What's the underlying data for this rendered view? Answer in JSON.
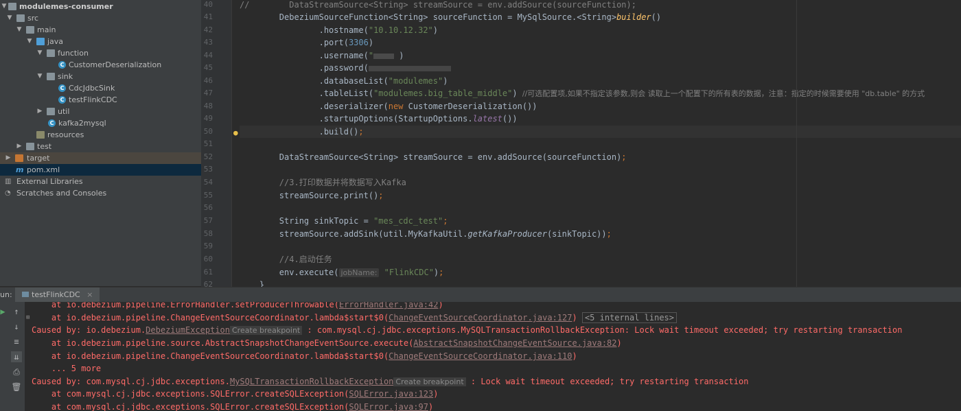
{
  "tree": [
    {
      "label": "modulemes-consumer",
      "bold": true
    },
    {
      "label": "src"
    },
    {
      "label": "main"
    },
    {
      "label": "java"
    },
    {
      "label": "function"
    },
    {
      "label": "CustomerDeserialization"
    },
    {
      "label": "sink"
    },
    {
      "label": "CdcJdbcSink"
    },
    {
      "label": "testFlinkCDC"
    },
    {
      "label": "util"
    },
    {
      "label": "kafka2mysql"
    },
    {
      "label": "resources"
    },
    {
      "label": "test"
    },
    {
      "label": "target"
    },
    {
      "label": "pom.xml"
    },
    {
      "label": "External Libraries"
    },
    {
      "label": "Scratches and Consoles"
    }
  ],
  "line_numbers": [
    "40",
    "41",
    "42",
    "43",
    "44",
    "45",
    "46",
    "47",
    "48",
    "49",
    "50",
    "51",
    "52",
    "53",
    "54",
    "55",
    "56",
    "57",
    "58",
    "59",
    "60",
    "61",
    "62"
  ],
  "code": {
    "l40": "//        DataStreamSource<String> streamSource = env.addSource(sourceFunction);",
    "l41a": "        DebeziumSourceFunction<String> sourceFunction = MySqlSource.<String>",
    "l41b": "builder",
    "l41c": "()",
    "l42a": "                .hostname(",
    "l42b": "\"10.10.12.32\"",
    "l42c": ")",
    "l43a": "                .port(",
    "l43b": "3306",
    "l43c": ")",
    "l44a": "                .username(",
    "l44b": "\"",
    "l44c": " )",
    "l45a": "                .password(",
    "l46a": "                .databaseList(",
    "l46b": "\"modulemes\"",
    "l46c": ")",
    "l47a": "                .tableList(",
    "l47b": "\"modulemes.big_table_middle\"",
    "l47c": ") ",
    "l47d": "//可选配置项,如果不指定该参数,则会 读取上一个配置下的所有表的数据，注意：指定的时候需要使用 \"db.table\" 的方式",
    "l48a": "                .deserializer(",
    "l48b": "new",
    "l48c": " CustomerDeserialization())",
    "l49a": "                .startupOptions(StartupOptions.",
    "l49b": "latest",
    "l49c": "())",
    "l50a": "                .build()",
    "l50b": ";",
    "l52a": "        DataStreamSource<String> streamSource = env.addSource(sourceFunction)",
    "l52b": ";",
    "l54": "        //3.打印数据并将数据写入Kafka",
    "l55a": "        streamSource.print()",
    "l55b": ";",
    "l57a": "        String sinkTopic = ",
    "l57b": "\"mes_cdc_test\"",
    "l57c": ";",
    "l58a": "        streamSource.addSink(util.MyKafkaUtil.",
    "l58b": "getKafkaProducer",
    "l58c": "(sinkTopic))",
    "l58d": ";",
    "l60": "        //4.启动任务",
    "l61a": "        env.execute(",
    "l61hint": "jobName:",
    "l61b": "\"FlinkCDC\"",
    "l61c": ")",
    "l61d": ";",
    "l62": "    }"
  },
  "run": {
    "label": "un:",
    "tab": "testFlinkCDC",
    "close": "×"
  },
  "console": {
    "c0a": "    at io.debezium.pipeline.ErrorHandler.setProducerThrowable(",
    "c0b": "ErrorHandler.java:42",
    "c0c": ")",
    "c1a": "    at io.debezium.pipeline.ChangeEventSourceCoordinator.lambda$start$0(",
    "c1b": "ChangeEventSourceCoordinator.java:127",
    "c1c": ")",
    "c1d": "<5 internal lines>",
    "c2a": "Caused by: io.debezium.",
    "c2b": "DebeziumException",
    "c2bp": "Create breakpoint",
    "c2c": " : com.mysql.cj.jdbc.exceptions.MySQLTransactionRollbackException: Lock wait timeout exceeded; try restarting transaction",
    "c3a": "    at io.debezium.pipeline.source.AbstractSnapshotChangeEventSource.execute(",
    "c3b": "AbstractSnapshotChangeEventSource.java:82",
    "c3c": ")",
    "c4a": "    at io.debezium.pipeline.ChangeEventSourceCoordinator.lambda$start$0(",
    "c4b": "ChangeEventSourceCoordinator.java:110",
    "c4c": ")",
    "c5": "    ... 5 more",
    "c6a": "Caused by: com.mysql.cj.jdbc.exceptions.",
    "c6b": "MySQLTransactionRollbackException",
    "c6bp": "Create breakpoint",
    "c6c": " : Lock wait timeout exceeded; try restarting transaction",
    "c7a": "    at com.mysql.cj.jdbc.exceptions.SQLError.createSQLException(",
    "c7b": "SQLError.java:123",
    "c7c": ")",
    "c8a": "    at com.mysql.cj.jdbc.exceptions.SQLError.createSQLException(",
    "c8b": "SQLError.java:97",
    "c8c": ")"
  },
  "colors": {
    "keyword": "#cc7832",
    "string": "#6a8759",
    "number": "#6897bb",
    "comment": "#808080",
    "error": "#ff6b68"
  }
}
